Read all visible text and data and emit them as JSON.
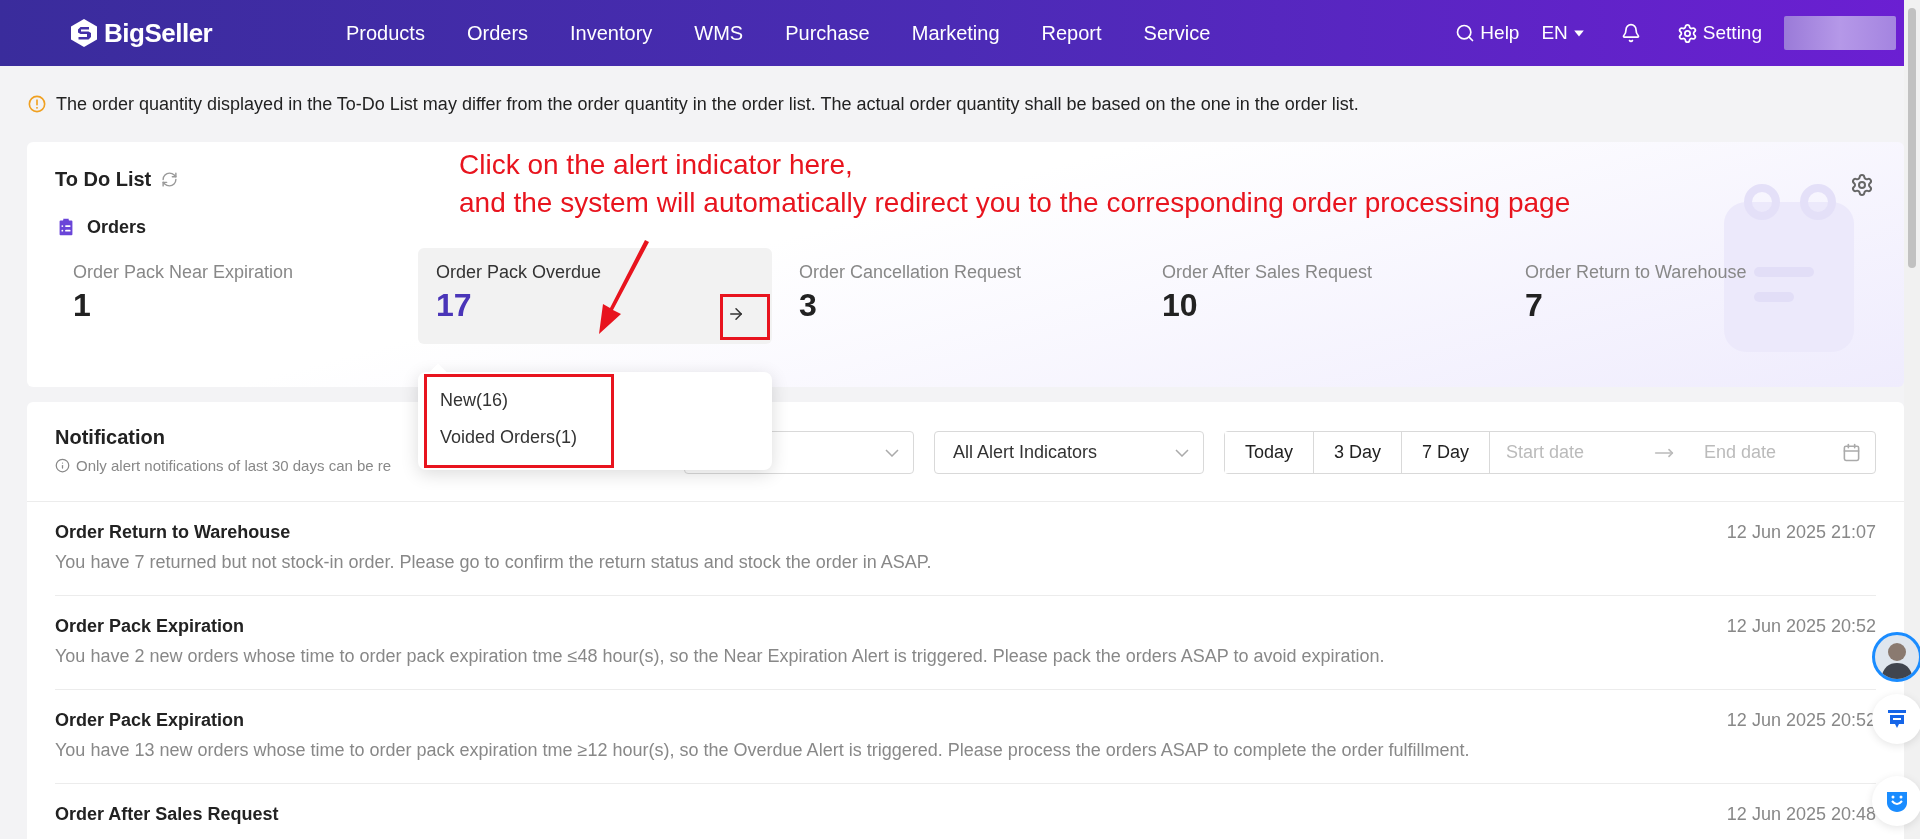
{
  "header": {
    "logo": "BigSeller",
    "nav": [
      "Products",
      "Orders",
      "Inventory",
      "WMS",
      "Purchase",
      "Marketing",
      "Report",
      "Service"
    ],
    "help": "Help",
    "language": "EN",
    "setting": "Setting"
  },
  "notice": "The order quantity displayed in the To-Do List may differ from the order quantity in the order list. The actual order quantity shall be based on the one in the order list.",
  "todo": {
    "title": "To Do List",
    "section": "Orders",
    "metrics": [
      {
        "label": "Order Pack Near Expiration",
        "value": "1",
        "selected": false
      },
      {
        "label": "Order Pack Overdue",
        "value": "17",
        "selected": true
      },
      {
        "label": "Order Cancellation Request",
        "value": "3",
        "selected": false
      },
      {
        "label": "Order After Sales Request",
        "value": "10",
        "selected": false
      },
      {
        "label": "Order Return to Warehouse",
        "value": "7",
        "selected": false
      }
    ],
    "popup": [
      "New(16)",
      "Voided Orders(1)"
    ]
  },
  "annotation": [
    "Click on the alert indicator here,",
    "and the system will automatically redirect you to the corresponding order processing page"
  ],
  "notification": {
    "title": "Notification",
    "hint": "Only alert notifications of last 30 days can be re",
    "alert_select": "All Alert Indicators",
    "ranges": [
      "Today",
      "3 Day",
      "7 Day"
    ],
    "start_placeholder": "Start date",
    "end_placeholder": "End date",
    "items": [
      {
        "title": "Order Return to Warehouse",
        "message": "You have 7 returned but not stock-in order. Please go to confirm the return status and stock the order in ASAP.",
        "time": "12 Jun 2025 21:07"
      },
      {
        "title": "Order Pack Expiration",
        "message": "You have 2 new orders whose time to order pack expiration tme ≤48 hour(s), so the Near Expiration Alert is triggered. Please pack the orders ASAP to avoid expiration.",
        "time": "12 Jun 2025 20:52"
      },
      {
        "title": "Order Pack Expiration",
        "message": "You have 13 new orders whose time to order pack expiration tme ≥12 hour(s), so the Overdue Alert is triggered. Please process the orders ASAP to complete the order fulfillment.",
        "time": "12 Jun 2025 20:52"
      },
      {
        "title": "Order After Sales Request",
        "time": "12 Jun 2025 20:48"
      }
    ]
  }
}
